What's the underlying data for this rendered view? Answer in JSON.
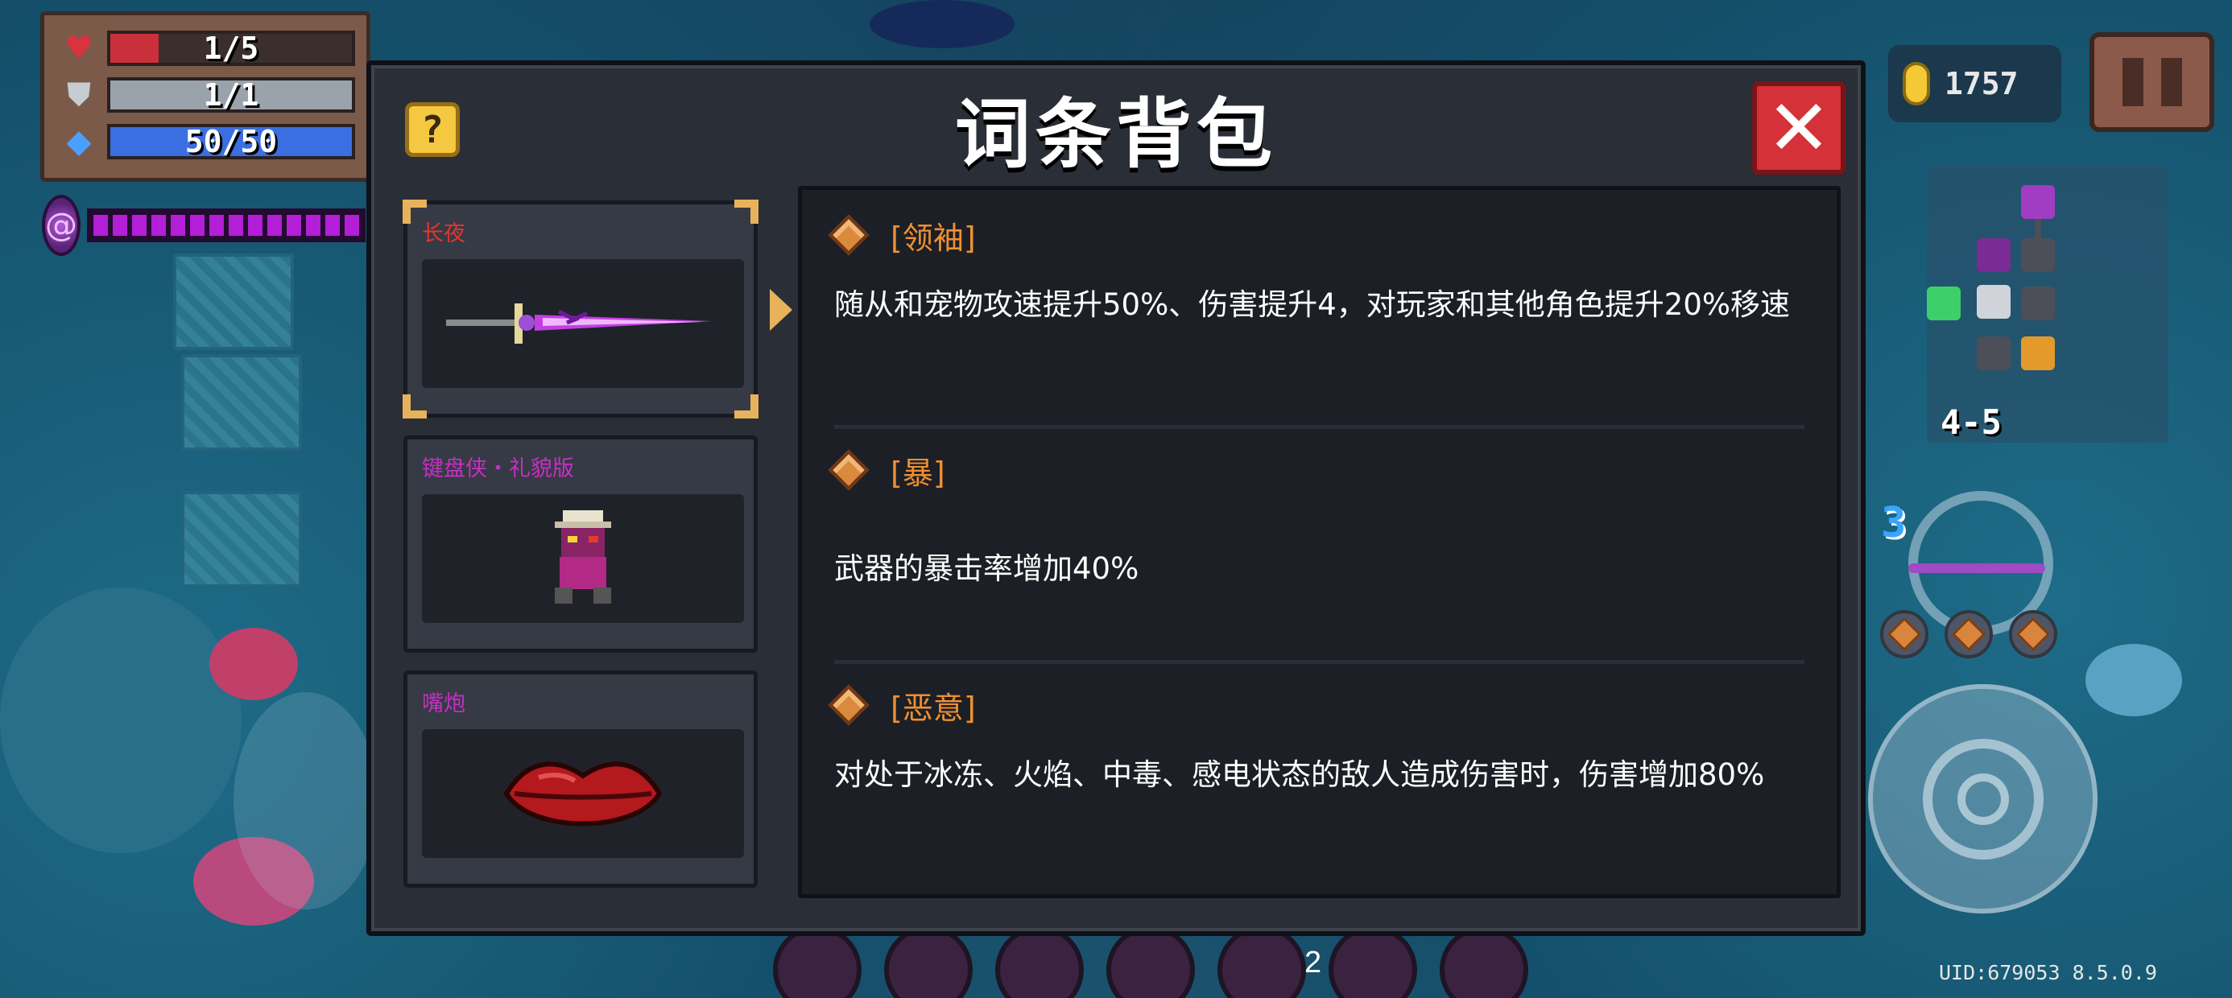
{
  "hud": {
    "hp": "1/5",
    "hp_fraction": 0.2,
    "armor": "1/1",
    "armor_fraction": 1,
    "energy": "50/50",
    "energy_fraction": 1,
    "coins": "1757",
    "level": "4-5",
    "weapon_energy_cost": "3",
    "page_indicator": "2",
    "uid": "UID:679053 8.5.0.9",
    "icons": {
      "hp": "heart-icon",
      "armor": "shield-icon",
      "energy": "diamond-icon",
      "coin": "coin-icon",
      "pause": "pause-icon"
    },
    "colors": {
      "hp": "#c9303b",
      "armor": "#9aa2ac",
      "energy": "#3b6ee0",
      "buff": "#b21fd6"
    }
  },
  "modal": {
    "title": "词条背包",
    "help_label": "?",
    "close_label": "✕"
  },
  "items": [
    {
      "name": "长夜",
      "name_color": "#e0362f",
      "selected": true,
      "icon": "dark-sword-icon"
    },
    {
      "name": "键盘侠・礼貌版",
      "name_color": "#c62fc4",
      "selected": false,
      "icon": "keyboard-warrior-icon"
    },
    {
      "name": "嘴炮",
      "name_color": "#c62fc4",
      "selected": false,
      "icon": "lips-icon"
    }
  ],
  "affixes": [
    {
      "name": "[领袖]",
      "description": "随从和宠物攻速提升50%、伤害提升4，对玩家和其他角色提升20%移速"
    },
    {
      "name": "[暴]",
      "description": "武器的暴击率增加40%"
    },
    {
      "name": "[恶意]",
      "description": "对处于冰冻、火焰、中毒、感电状态的敌人造成伤害时，伤害增加80%"
    }
  ]
}
